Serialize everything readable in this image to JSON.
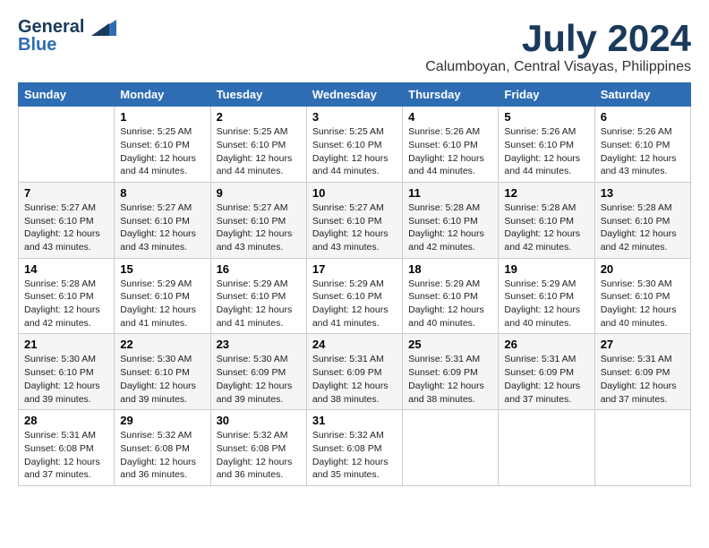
{
  "logo": {
    "general": "General",
    "blue": "Blue"
  },
  "title": {
    "month": "July 2024",
    "location": "Calumboyan, Central Visayas, Philippines"
  },
  "headers": [
    "Sunday",
    "Monday",
    "Tuesday",
    "Wednesday",
    "Thursday",
    "Friday",
    "Saturday"
  ],
  "weeks": [
    [
      {
        "day": "",
        "info": ""
      },
      {
        "day": "1",
        "info": "Sunrise: 5:25 AM\nSunset: 6:10 PM\nDaylight: 12 hours\nand 44 minutes."
      },
      {
        "day": "2",
        "info": "Sunrise: 5:25 AM\nSunset: 6:10 PM\nDaylight: 12 hours\nand 44 minutes."
      },
      {
        "day": "3",
        "info": "Sunrise: 5:25 AM\nSunset: 6:10 PM\nDaylight: 12 hours\nand 44 minutes."
      },
      {
        "day": "4",
        "info": "Sunrise: 5:26 AM\nSunset: 6:10 PM\nDaylight: 12 hours\nand 44 minutes."
      },
      {
        "day": "5",
        "info": "Sunrise: 5:26 AM\nSunset: 6:10 PM\nDaylight: 12 hours\nand 44 minutes."
      },
      {
        "day": "6",
        "info": "Sunrise: 5:26 AM\nSunset: 6:10 PM\nDaylight: 12 hours\nand 43 minutes."
      }
    ],
    [
      {
        "day": "7",
        "info": "Sunrise: 5:27 AM\nSunset: 6:10 PM\nDaylight: 12 hours\nand 43 minutes."
      },
      {
        "day": "8",
        "info": "Sunrise: 5:27 AM\nSunset: 6:10 PM\nDaylight: 12 hours\nand 43 minutes."
      },
      {
        "day": "9",
        "info": "Sunrise: 5:27 AM\nSunset: 6:10 PM\nDaylight: 12 hours\nand 43 minutes."
      },
      {
        "day": "10",
        "info": "Sunrise: 5:27 AM\nSunset: 6:10 PM\nDaylight: 12 hours\nand 43 minutes."
      },
      {
        "day": "11",
        "info": "Sunrise: 5:28 AM\nSunset: 6:10 PM\nDaylight: 12 hours\nand 42 minutes."
      },
      {
        "day": "12",
        "info": "Sunrise: 5:28 AM\nSunset: 6:10 PM\nDaylight: 12 hours\nand 42 minutes."
      },
      {
        "day": "13",
        "info": "Sunrise: 5:28 AM\nSunset: 6:10 PM\nDaylight: 12 hours\nand 42 minutes."
      }
    ],
    [
      {
        "day": "14",
        "info": "Sunrise: 5:28 AM\nSunset: 6:10 PM\nDaylight: 12 hours\nand 42 minutes."
      },
      {
        "day": "15",
        "info": "Sunrise: 5:29 AM\nSunset: 6:10 PM\nDaylight: 12 hours\nand 41 minutes."
      },
      {
        "day": "16",
        "info": "Sunrise: 5:29 AM\nSunset: 6:10 PM\nDaylight: 12 hours\nand 41 minutes."
      },
      {
        "day": "17",
        "info": "Sunrise: 5:29 AM\nSunset: 6:10 PM\nDaylight: 12 hours\nand 41 minutes."
      },
      {
        "day": "18",
        "info": "Sunrise: 5:29 AM\nSunset: 6:10 PM\nDaylight: 12 hours\nand 40 minutes."
      },
      {
        "day": "19",
        "info": "Sunrise: 5:29 AM\nSunset: 6:10 PM\nDaylight: 12 hours\nand 40 minutes."
      },
      {
        "day": "20",
        "info": "Sunrise: 5:30 AM\nSunset: 6:10 PM\nDaylight: 12 hours\nand 40 minutes."
      }
    ],
    [
      {
        "day": "21",
        "info": "Sunrise: 5:30 AM\nSunset: 6:10 PM\nDaylight: 12 hours\nand 39 minutes."
      },
      {
        "day": "22",
        "info": "Sunrise: 5:30 AM\nSunset: 6:10 PM\nDaylight: 12 hours\nand 39 minutes."
      },
      {
        "day": "23",
        "info": "Sunrise: 5:30 AM\nSunset: 6:09 PM\nDaylight: 12 hours\nand 39 minutes."
      },
      {
        "day": "24",
        "info": "Sunrise: 5:31 AM\nSunset: 6:09 PM\nDaylight: 12 hours\nand 38 minutes."
      },
      {
        "day": "25",
        "info": "Sunrise: 5:31 AM\nSunset: 6:09 PM\nDaylight: 12 hours\nand 38 minutes."
      },
      {
        "day": "26",
        "info": "Sunrise: 5:31 AM\nSunset: 6:09 PM\nDaylight: 12 hours\nand 37 minutes."
      },
      {
        "day": "27",
        "info": "Sunrise: 5:31 AM\nSunset: 6:09 PM\nDaylight: 12 hours\nand 37 minutes."
      }
    ],
    [
      {
        "day": "28",
        "info": "Sunrise: 5:31 AM\nSunset: 6:08 PM\nDaylight: 12 hours\nand 37 minutes."
      },
      {
        "day": "29",
        "info": "Sunrise: 5:32 AM\nSunset: 6:08 PM\nDaylight: 12 hours\nand 36 minutes."
      },
      {
        "day": "30",
        "info": "Sunrise: 5:32 AM\nSunset: 6:08 PM\nDaylight: 12 hours\nand 36 minutes."
      },
      {
        "day": "31",
        "info": "Sunrise: 5:32 AM\nSunset: 6:08 PM\nDaylight: 12 hours\nand 35 minutes."
      },
      {
        "day": "",
        "info": ""
      },
      {
        "day": "",
        "info": ""
      },
      {
        "day": "",
        "info": ""
      }
    ]
  ]
}
